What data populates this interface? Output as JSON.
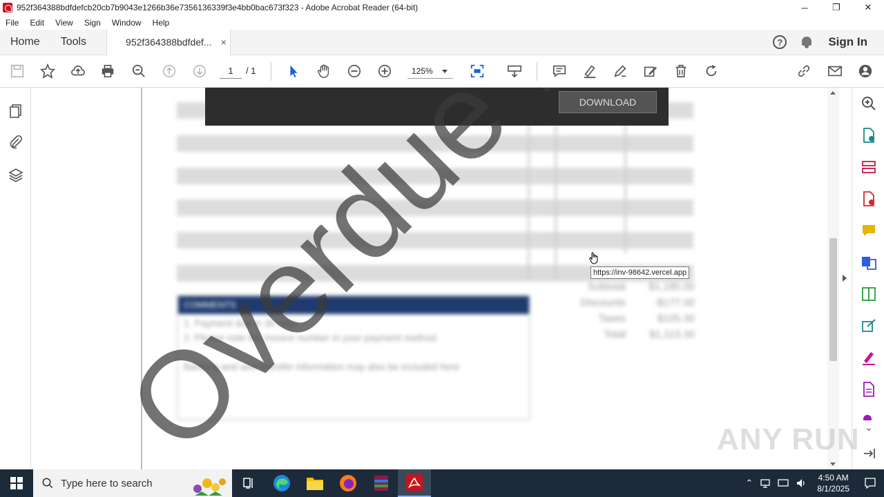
{
  "window": {
    "title": "952f364388bdfdefcb20cb7b9043e1266b36e7356136339f3e4bb0bac673f323 - Adobe Acrobat Reader (64-bit)",
    "minimize": "─",
    "maximize": "❐",
    "close": "✕"
  },
  "menu": [
    "File",
    "Edit",
    "View",
    "Sign",
    "Window",
    "Help"
  ],
  "tabs": {
    "home": "Home",
    "tools": "Tools",
    "document": "952f364388bdfdef...",
    "close": "×",
    "signin": "Sign In",
    "help": "?"
  },
  "toolbar": {
    "page_current": "1",
    "page_total": "/ 1",
    "zoom": "125%"
  },
  "document": {
    "download_button": "DOWNLOAD",
    "watermark": "Overdue In",
    "comments_header": "COMMENTS",
    "comment_lines": [
      "1. Payment due in 30 days",
      "2. Please note the invoice number in your payment method",
      "",
      "Banking and wire transfer information may also be included here"
    ],
    "totals": [
      {
        "label": "Subtotal",
        "value": "$1,185.00"
      },
      {
        "label": "Discounts",
        "value": "-$177.00"
      },
      {
        "label": "Taxes",
        "value": "$105.30"
      },
      {
        "label": "Total",
        "value": "$1,113.30"
      }
    ],
    "link_tooltip": "https://inv-98642.vercel.app"
  },
  "watermark_brand": "ANY RUN",
  "taskbar": {
    "search_placeholder": "Type here to search",
    "time": "4:50 AM",
    "date": "8/1/2025"
  },
  "colors": {
    "acrobat_red": "#c8141e",
    "comments_header_bg": "#1f3a6e",
    "select_blue": "#1a62c9",
    "taskbar_bg": "#1c2a3a"
  }
}
